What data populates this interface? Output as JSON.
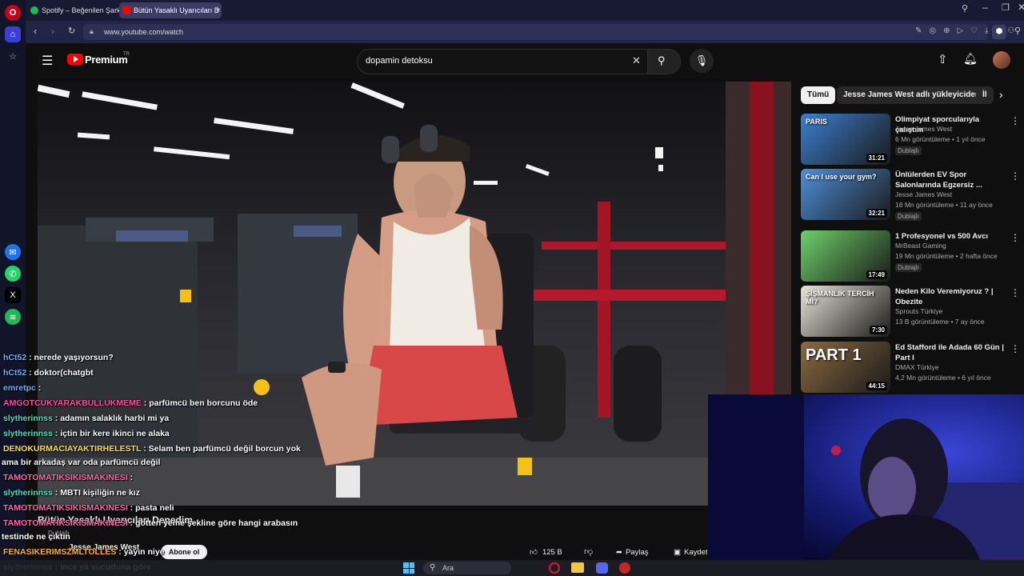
{
  "browser": {
    "tabs": [
      {
        "label": "Spotify – Beğenilen Şarkıl"
      },
      {
        "label": "Bütün Yasaklı Uyarıcıları D"
      }
    ],
    "url": "www.youtube.com/watch"
  },
  "youtube": {
    "logo_text": "Premium",
    "logo_region": "TR",
    "search_value": "dopamin detoksu"
  },
  "video": {
    "title_overlay": "Bütün Yasaklı Uyarıcıları Denedim",
    "channel": "Jesse James West",
    "dub_badge": "Dublajlı",
    "subscribe_label": "Abone ol",
    "likes": "125 B",
    "share_label": "Paylaş",
    "save_label": "Kaydet"
  },
  "chat": [
    {
      "user": "hCt52",
      "msg": "nerede yaşıyorsun?",
      "color": "#6ab0ff"
    },
    {
      "user": "hCt52",
      "msg": "doktor(chatgbt",
      "color": "#6ab0ff"
    },
    {
      "user": "emretpc",
      "msg": "",
      "color": "#6ab0ff"
    },
    {
      "user": "AMGOTCUKYARAKBULLUKMEME",
      "msg": "parfümcü ben borcunu öde",
      "color": "#ff4fa0"
    },
    {
      "user": "slytherinnss",
      "msg": "adamın salaklık harbi mi ya",
      "color": "#4fe0c0"
    },
    {
      "user": "slytherinnss",
      "msg": "içtin bir kere ikinci ne alaka",
      "color": "#4fe0c0"
    },
    {
      "user": "DENOKURMACIAYAKTIRHELESTL",
      "msg": "Selam ben parfümcü değil borcun yok",
      "color": "#ffe04a"
    },
    {
      "user": "",
      "msg": "ama bir arkadaş var oda parfümcü değil",
      "color": "#ffffff"
    },
    {
      "user": "TAMOTOMATIKSIKISMAKINESI",
      "msg": "",
      "color": "#ff6aa8"
    },
    {
      "user": "slytherinnss",
      "msg": "MBTI kişiliğin ne kız",
      "color": "#4fe0c0"
    },
    {
      "user": "TAMOTOMATIKSIKISMAKINESI",
      "msg": "pasta neli",
      "color": "#ff6aa8"
    },
    {
      "user": "TAMOTOMATIKSIKISMAKINESI",
      "msg": "gotten yeme şekline göre hangi arabasın",
      "color": "#ff6aa8"
    },
    {
      "user": "",
      "msg": "testinde ne çıktın",
      "color": "#ffffff"
    },
    {
      "user": "FENASIKERIMSZMLTOLLES",
      "msg": "yayın niye",
      "color": "#ffb030"
    },
    {
      "user": "slytherinnss",
      "msg": "ince ya vucuduna göre",
      "color": "#4fe0c0"
    }
  ],
  "sidebar_right": {
    "chips": [
      {
        "label": "Tümü"
      },
      {
        "label": "Jesse James West adlı yükleyiciden"
      },
      {
        "label": "İl"
      }
    ],
    "recommendations": [
      {
        "title": "Olimpiyat sporcularıyla çalıştım",
        "channel": "Jesse James West",
        "meta": "6 Mn görüntüleme • 1 yıl önce",
        "badge": "Dublajlı",
        "duration": "31:21",
        "thumb_text": "PARIS",
        "thumb_color": "#3a7fd0"
      },
      {
        "title": "Ünlülerden EV Spor Salonlarında Egzersiz ...",
        "channel": "Jesse James West",
        "meta": "18 Mn görüntüleme • 11 ay önce",
        "badge": "Dublajlı",
        "duration": "32:21",
        "thumb_text": "Can I use your gym?",
        "thumb_color": "#4f8fd9"
      },
      {
        "title": "1 Profesyonel vs 500 Avcı",
        "channel": "MrBeast Gaming",
        "meta": "19 Mn görüntüleme • 2 hafta önce",
        "badge": "Dublajlı",
        "duration": "17:49",
        "thumb_text": "",
        "thumb_color": "#6fd06a"
      },
      {
        "title": "Neden Kilo Veremiyoruz ? | Obezite",
        "channel": "Sprouts Türkiye",
        "meta": "13 B görüntüleme • 7 ay önce",
        "badge": "",
        "duration": "7:30",
        "thumb_text": "ŞİŞMANLIK TERCİH Mİ?",
        "thumb_color": "#e8e4d8"
      },
      {
        "title": "Ed Stafford ile Adada 60 Gün | Part I",
        "channel": "DMAX Türkiye",
        "meta": "4,2 Mn görüntüleme • 6 yıl önce",
        "badge": "",
        "duration": "44:15",
        "thumb_text": "PART 1",
        "thumb_color": "#8a6a40"
      }
    ]
  },
  "taskbar": {
    "search_label": "Ara"
  }
}
